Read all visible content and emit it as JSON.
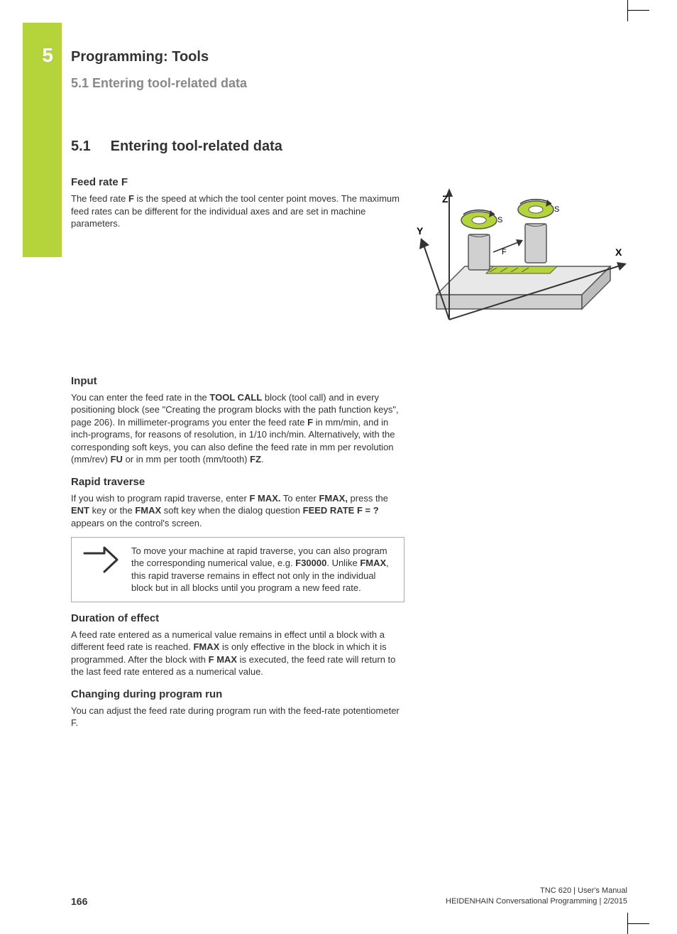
{
  "chapter": {
    "number": "5",
    "title": "Programming: Tools"
  },
  "subheading_top": "5.1    Entering tool-related data",
  "section": {
    "number": "5.1",
    "title": "Entering tool-related data"
  },
  "feed_rate": {
    "heading": "Feed rate F",
    "intro": {
      "pre": "The feed rate ",
      "b1": "F",
      "post": " is the speed at which the tool center point moves. The maximum feed rates can be different for the individual axes and are set in machine parameters."
    }
  },
  "diagram": {
    "x": "X",
    "y": "Y",
    "z": "Z",
    "s": "S",
    "f": "F"
  },
  "input": {
    "heading": "Input",
    "p1": "You can enter the feed rate in the ",
    "b1": "TOOL CALL",
    "p2": " block (tool call) and in every positioning block (see \"Creating the program blocks with the path function keys\", page 206). In millimeter-programs you enter the feed rate ",
    "b2": "F",
    "p3": " in mm/min, and in inch-programs, for reasons of resolution, in 1/10 inch/min. Alternatively, with the corresponding soft keys, you can also define the feed rate in mm per revolution (mm/rev) ",
    "b3": "FU",
    "p4": " or in mm per tooth (mm/tooth) ",
    "b4": "FZ",
    "p5": "."
  },
  "rapid": {
    "heading": "Rapid traverse",
    "p1": "If you wish to program rapid traverse, enter ",
    "b1": "F MAX.",
    "p2": " To enter ",
    "b2": "FMAX,",
    "p3": " press the ",
    "b3": "ENT",
    "p4": " key or the ",
    "b4": "FMAX",
    "p5": " soft key when the dialog question ",
    "b5": "FEED RATE F = ?",
    "p6": " appears on the control's screen."
  },
  "note": {
    "p1": "To move your machine at rapid traverse, you can also program the corresponding numerical value, e.g. ",
    "b1": "F30000",
    "p2": ". Unlike ",
    "b2": "FMAX",
    "p3": ", this rapid traverse remains in effect not only in the individual block but in all blocks until you program a new feed rate."
  },
  "duration": {
    "heading": "Duration of effect",
    "p1": "A feed rate entered as a numerical value remains in effect until a block with a different feed rate is reached. ",
    "b1": "FMAX",
    "p2": " is only effective in the block in which it is programmed. After the block with ",
    "b2": "F MAX",
    "p3": " is executed, the feed rate will return to the last feed rate entered as a numerical value."
  },
  "changing": {
    "heading": "Changing during program run",
    "para": "You can adjust the feed rate during program run with the feed-rate potentiometer F."
  },
  "footer": {
    "page": "166",
    "line1": "TNC 620 | User's Manual",
    "line2": "HEIDENHAIN Conversational Programming | 2/2015"
  }
}
